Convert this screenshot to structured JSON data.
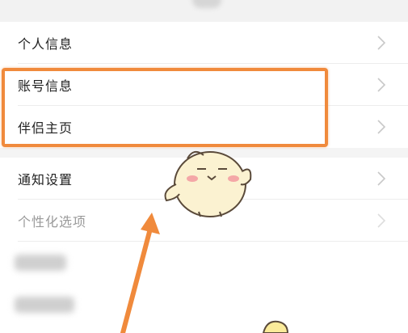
{
  "settings": {
    "group1": [
      {
        "label": "个人信息"
      },
      {
        "label": "账号信息"
      },
      {
        "label": "伴侣主页"
      }
    ],
    "group2": [
      {
        "label": "通知设置"
      },
      {
        "label": "个性化选项"
      }
    ],
    "chevron_icon": "chevron-right-icon"
  },
  "annotation": {
    "highlight_color": "#f08a3c",
    "arrow_color": "#f08a3c",
    "sticker_name": "chick-sticker"
  }
}
